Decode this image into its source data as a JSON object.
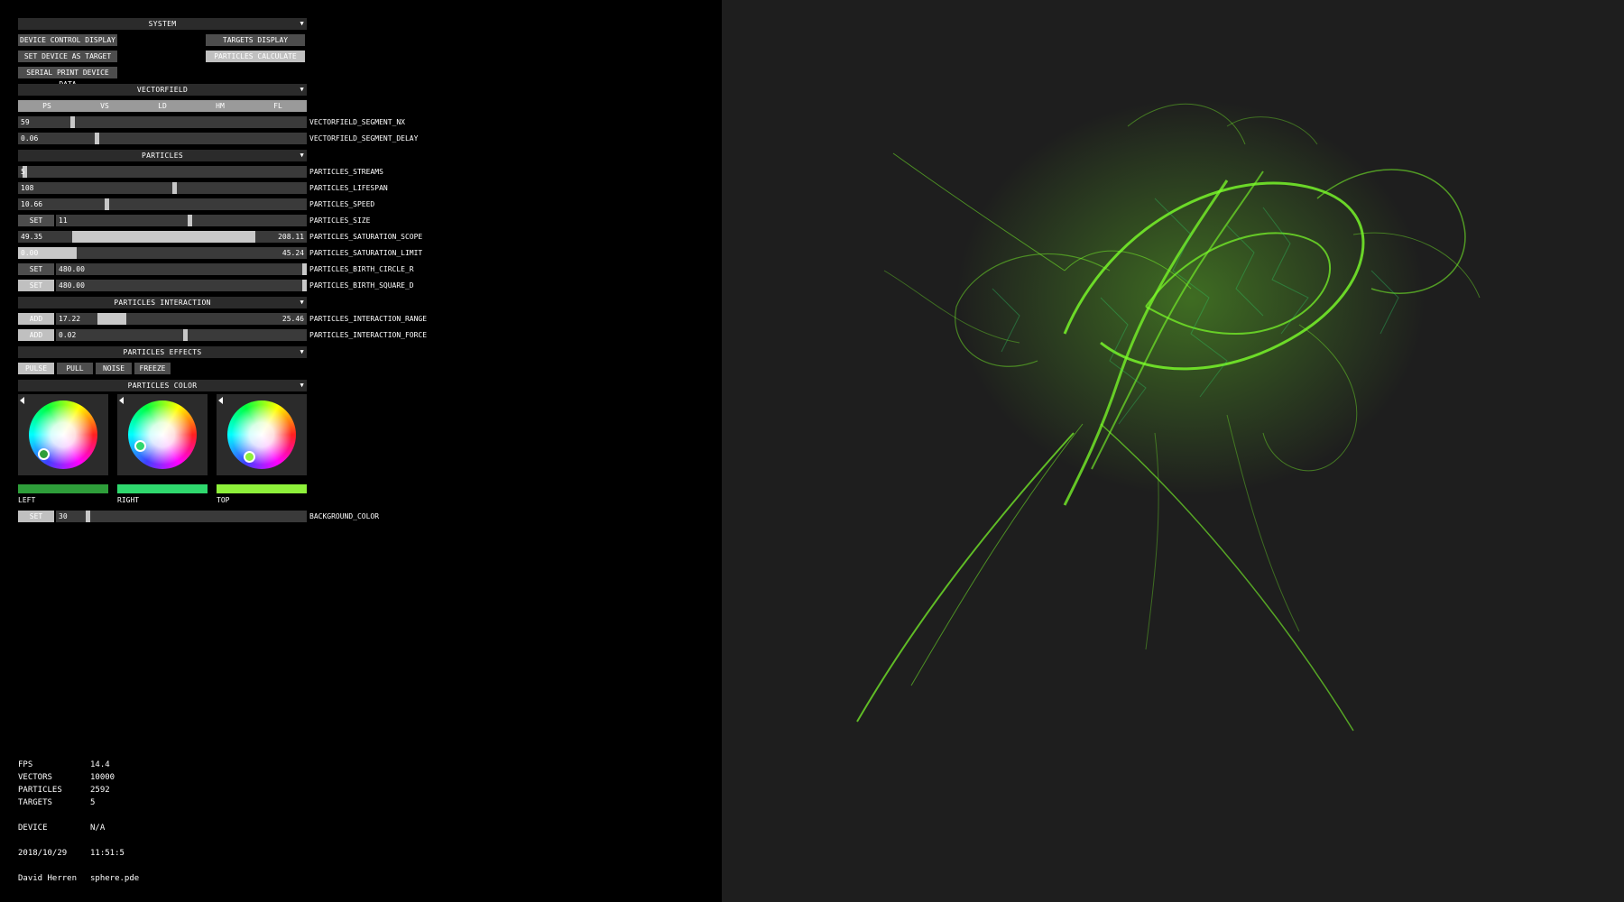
{
  "system": {
    "header": "SYSTEM",
    "buttons": {
      "device_control_display": "DEVICE CONTROL DISPLAY",
      "targets_display": "TARGETS DISPLAY",
      "set_device_as_target": "SET DEVICE AS TARGET",
      "particles_calculate": "PARTICLES CALCULATE",
      "serial_print_device_data": "SERIAL PRINT DEVICE DATA"
    }
  },
  "vectorfield": {
    "header": "VECTORFIELD",
    "tabs": [
      "PS",
      "VS",
      "LD",
      "HM",
      "FL"
    ],
    "segment_nx": {
      "value": "59",
      "label": "VECTORFIELD_SEGMENT_NX"
    },
    "segment_delay": {
      "value": "0.06",
      "label": "VECTORFIELD_SEGMENT_DELAY"
    }
  },
  "particles": {
    "header": "PARTICLES",
    "streams": {
      "value": "5",
      "label": "PARTICLES_STREAMS"
    },
    "lifespan": {
      "value": "108",
      "label": "PARTICLES_LIFESPAN"
    },
    "speed": {
      "value": "10.66",
      "label": "PARTICLES_SPEED"
    },
    "size": {
      "button": "SET",
      "value": "11",
      "label": "PARTICLES_SIZE"
    },
    "saturation_scope": {
      "min": "49.35",
      "max": "208.11",
      "label": "PARTICLES_SATURATION_SCOPE"
    },
    "saturation_limit": {
      "min": "0.00",
      "max": "45.24",
      "label": "PARTICLES_SATURATION_LIMIT"
    },
    "birth_circle_r": {
      "button": "SET",
      "value": "480.00",
      "label": "PARTICLES_BIRTH_CIRCLE_R"
    },
    "birth_square_d": {
      "button": "SET",
      "value": "480.00",
      "label": "PARTICLES_BIRTH_SQUARE_D"
    }
  },
  "interaction": {
    "header": "PARTICLES INTERACTION",
    "range": {
      "button": "ADD",
      "min": "17.22",
      "max": "25.46",
      "label": "PARTICLES_INTERACTION_RANGE"
    },
    "force": {
      "button": "ADD",
      "value": "0.02",
      "label": "PARTICLES_INTERACTION_FORCE"
    }
  },
  "effects": {
    "header": "PARTICLES EFFECTS",
    "buttons": [
      "PULSE",
      "PULL",
      "NOISE",
      "FREEZE"
    ]
  },
  "color": {
    "header": "PARTICLES COLOR",
    "wheels": [
      {
        "label": "LEFT",
        "swatch": "#2e9e3a"
      },
      {
        "label": "RIGHT",
        "swatch": "#2fd86e"
      },
      {
        "label": "TOP",
        "swatch": "#8ef03a"
      }
    ],
    "background": {
      "button": "SET",
      "value": "30",
      "label": "BACKGROUND_COLOR"
    }
  },
  "stats": {
    "fps_label": "FPS",
    "fps": "14.4",
    "vectors_label": "VECTORS",
    "vectors": "10000",
    "particles_label": "PARTICLES",
    "particles": "2592",
    "targets_label": "TARGETS",
    "targets": "5",
    "device_label": "DEVICE",
    "device": "N/A",
    "date": "2018/10/29",
    "time": "11:51:5",
    "author": "David Herren",
    "file": "sphere.pde"
  },
  "colors": {
    "viz_background": "#1e1e1e",
    "particle_green": "#7cff2a"
  }
}
